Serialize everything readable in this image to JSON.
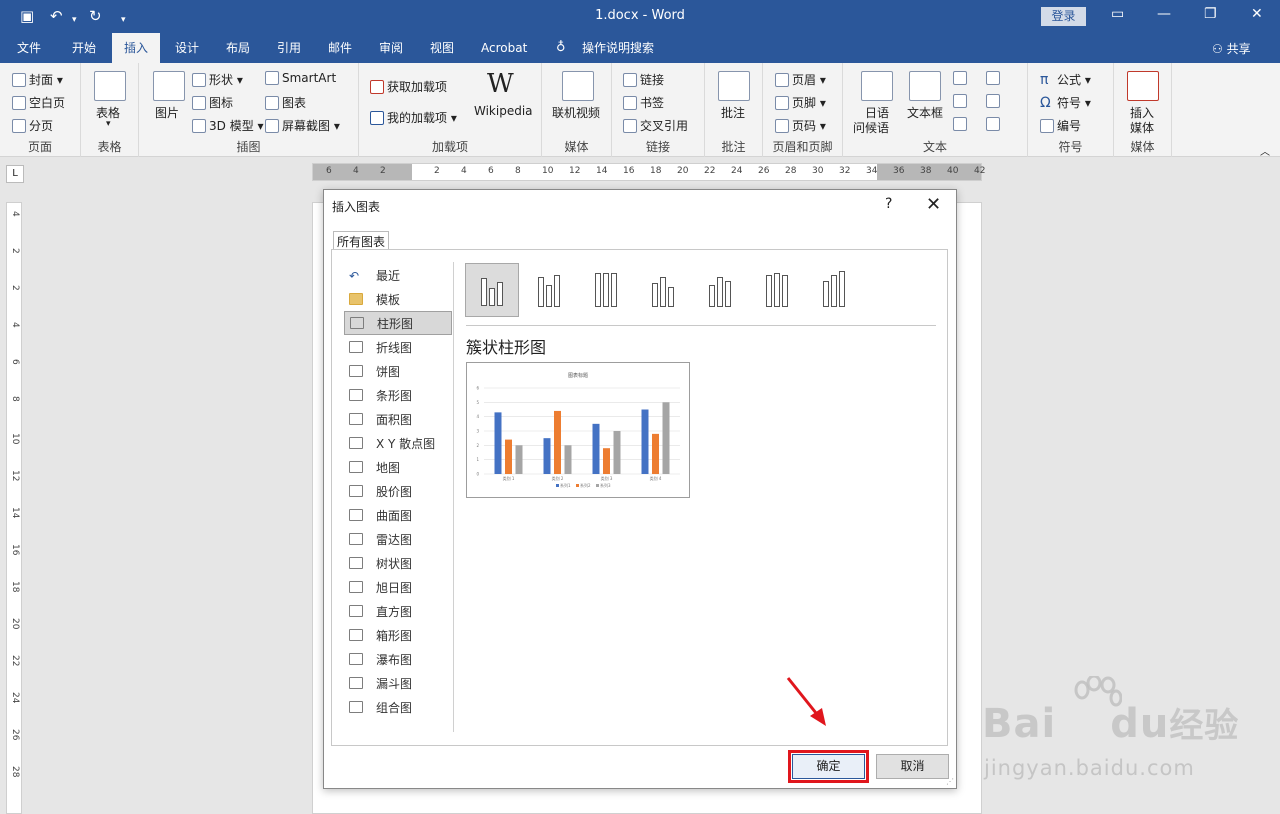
{
  "title_bar": {
    "doc_title": "1.docx  -  Word",
    "login": "登录",
    "quick_access": [
      "save-icon",
      "undo-icon",
      "redo-icon",
      "customize-icon"
    ]
  },
  "tabs": [
    "文件",
    "开始",
    "插入",
    "设计",
    "布局",
    "引用",
    "邮件",
    "审阅",
    "视图",
    "Acrobat",
    "操作说明搜索"
  ],
  "active_tab": "插入",
  "share": "共享",
  "ribbon": {
    "pages": {
      "items": [
        "封面",
        "空白页",
        "分页"
      ],
      "label": "页面"
    },
    "table": {
      "big": "表格",
      "label": "表格"
    },
    "illustrations": {
      "big": "图片",
      "items": [
        "形状",
        "图标",
        "3D 模型"
      ],
      "items2": [
        "SmartArt",
        "图表",
        "屏幕截图"
      ],
      "label": "插图"
    },
    "addins": {
      "items": [
        "获取加载项",
        "我的加载项"
      ],
      "big": "Wikipedia",
      "label": "加载项"
    },
    "media": {
      "big": "联机视频",
      "label": "媒体"
    },
    "links": {
      "items": [
        "链接",
        "书签",
        "交叉引用"
      ],
      "label": "链接"
    },
    "comments": {
      "big": "批注",
      "label": "批注"
    },
    "header_footer": {
      "items": [
        "页眉",
        "页脚",
        "页码"
      ],
      "label": "页眉和页脚"
    },
    "text": {
      "big1": "日语\n问候语",
      "big1_a": "日语",
      "big1_b": "问候语",
      "big2": "文本框",
      "label": "文本"
    },
    "symbols": {
      "items": [
        "公式",
        "符号",
        "编号"
      ],
      "label": "符号"
    },
    "media2": {
      "big_a": "插入",
      "big_b": "媒体",
      "label": "媒体"
    }
  },
  "hruler_numbers": [
    "6",
    "4",
    "2",
    "2",
    "4",
    "6",
    "8",
    "10",
    "12",
    "14",
    "16",
    "18",
    "20",
    "22",
    "24",
    "26",
    "28",
    "30",
    "32",
    "34",
    "36",
    "38",
    "40",
    "42"
  ],
  "vruler_numbers": [
    "4",
    "2",
    "2",
    "4",
    "6",
    "8",
    "10",
    "12",
    "14",
    "16",
    "18",
    "20",
    "22",
    "24",
    "26",
    "28"
  ],
  "dialog": {
    "title": "插入图表",
    "help": "?",
    "close": "✕",
    "tab": "所有图表",
    "chart_types": [
      "最近",
      "模板",
      "柱形图",
      "折线图",
      "饼图",
      "条形图",
      "面积图",
      "X Y 散点图",
      "地图",
      "股价图",
      "曲面图",
      "雷达图",
      "树状图",
      "旭日图",
      "直方图",
      "箱形图",
      "瀑布图",
      "漏斗图",
      "组合图"
    ],
    "selected_type": "柱形图",
    "subtype_name": "簇状柱形图",
    "ok": "确定",
    "cancel": "取消"
  },
  "chart_data": {
    "type": "bar",
    "title": "图表标题",
    "categories": [
      "类别 1",
      "类别 2",
      "类别 3",
      "类别 4"
    ],
    "series": [
      {
        "name": "系列1",
        "values": [
          4.3,
          2.5,
          3.5,
          4.5
        ],
        "color": "#4472c4"
      },
      {
        "name": "系列2",
        "values": [
          2.4,
          4.4,
          1.8,
          2.8
        ],
        "color": "#ed7d31"
      },
      {
        "name": "系列3",
        "values": [
          2,
          2,
          3,
          5
        ],
        "color": "#a5a5a5"
      }
    ],
    "ylim": [
      0,
      6
    ],
    "yticks": [
      "0",
      "1",
      "2",
      "3",
      "4",
      "5",
      "6"
    ],
    "grid": true,
    "legend": "bottom"
  },
  "watermark": {
    "logo_a": "Bai",
    "logo_b": "du",
    "logo_c": "经验",
    "url": "jingyan.baidu.com"
  }
}
